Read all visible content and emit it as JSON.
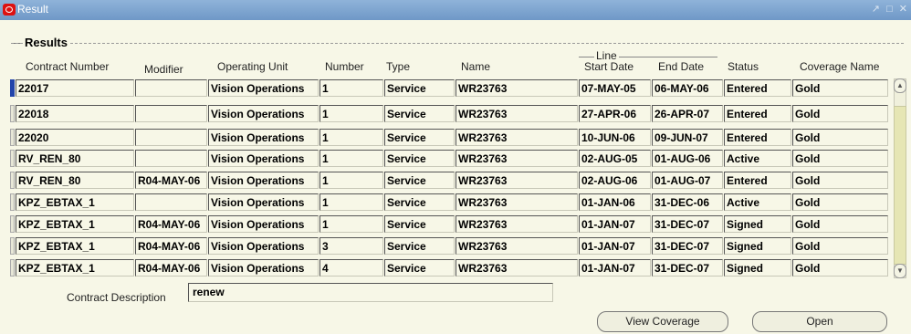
{
  "window": {
    "title": "Result",
    "controls": "↗ □ ✕"
  },
  "section": {
    "title": "Results",
    "group_label": "Line"
  },
  "columns": {
    "contract_number": "Contract Number",
    "modifier": "Modifier",
    "operating_unit": "Operating Unit",
    "number": "Number",
    "type": "Type",
    "name": "Name",
    "start_date": "Start Date",
    "end_date": "End Date",
    "status": "Status",
    "coverage_name": "Coverage Name"
  },
  "rows": [
    {
      "contract_number": "22017",
      "modifier": "",
      "operating_unit": "Vision Operations",
      "number": "1",
      "type": "Service",
      "name": "WR23763",
      "start_date": "07-MAY-05",
      "end_date": "06-MAY-06",
      "status": "Entered",
      "coverage_name": "Gold"
    },
    {
      "contract_number": "22018",
      "modifier": "",
      "operating_unit": "Vision Operations",
      "number": "1",
      "type": "Service",
      "name": "WR23763",
      "start_date": "27-APR-06",
      "end_date": "26-APR-07",
      "status": "Entered",
      "coverage_name": "Gold"
    },
    {
      "contract_number": "22020",
      "modifier": "",
      "operating_unit": "Vision Operations",
      "number": "1",
      "type": "Service",
      "name": "WR23763",
      "start_date": "10-JUN-06",
      "end_date": "09-JUN-07",
      "status": "Entered",
      "coverage_name": "Gold"
    },
    {
      "contract_number": "RV_REN_80",
      "modifier": "",
      "operating_unit": "Vision Operations",
      "number": "1",
      "type": "Service",
      "name": "WR23763",
      "start_date": "02-AUG-05",
      "end_date": "01-AUG-06",
      "status": "Active",
      "coverage_name": "Gold"
    },
    {
      "contract_number": "RV_REN_80",
      "modifier": "R04-MAY-06",
      "operating_unit": "Vision Operations",
      "number": "1",
      "type": "Service",
      "name": "WR23763",
      "start_date": "02-AUG-06",
      "end_date": "01-AUG-07",
      "status": "Entered",
      "coverage_name": "Gold"
    },
    {
      "contract_number": "KPZ_EBTAX_1",
      "modifier": "",
      "operating_unit": "Vision Operations",
      "number": "1",
      "type": "Service",
      "name": "WR23763",
      "start_date": "01-JAN-06",
      "end_date": "31-DEC-06",
      "status": "Active",
      "coverage_name": "Gold"
    },
    {
      "contract_number": "KPZ_EBTAX_1",
      "modifier": "R04-MAY-06",
      "operating_unit": "Vision Operations",
      "number": "1",
      "type": "Service",
      "name": "WR23763",
      "start_date": "01-JAN-07",
      "end_date": "31-DEC-07",
      "status": "Signed",
      "coverage_name": "Gold"
    },
    {
      "contract_number": "KPZ_EBTAX_1",
      "modifier": "R04-MAY-06",
      "operating_unit": "Vision Operations",
      "number": "3",
      "type": "Service",
      "name": "WR23763",
      "start_date": "01-JAN-07",
      "end_date": "31-DEC-07",
      "status": "Signed",
      "coverage_name": "Gold"
    },
    {
      "contract_number": "KPZ_EBTAX_1",
      "modifier": "R04-MAY-06",
      "operating_unit": "Vision Operations",
      "number": "4",
      "type": "Service",
      "name": "WR23763",
      "start_date": "01-JAN-07",
      "end_date": "31-DEC-07",
      "status": "Signed",
      "coverage_name": "Gold"
    }
  ],
  "description": {
    "label": "Contract Description",
    "value": "renew"
  },
  "buttons": {
    "view_coverage": "View Coverage",
    "open": "Open"
  },
  "icons": {
    "app": "oracle-forms-icon",
    "scroll_up": "scroll-up-arrow-icon",
    "scroll_down": "scroll-down-arrow-icon"
  },
  "colors": {
    "titlebar": "#7aa2cf",
    "background": "#f7f7e7",
    "selected_row_marker": "#2244aa",
    "app_icon": "#dd1111"
  }
}
